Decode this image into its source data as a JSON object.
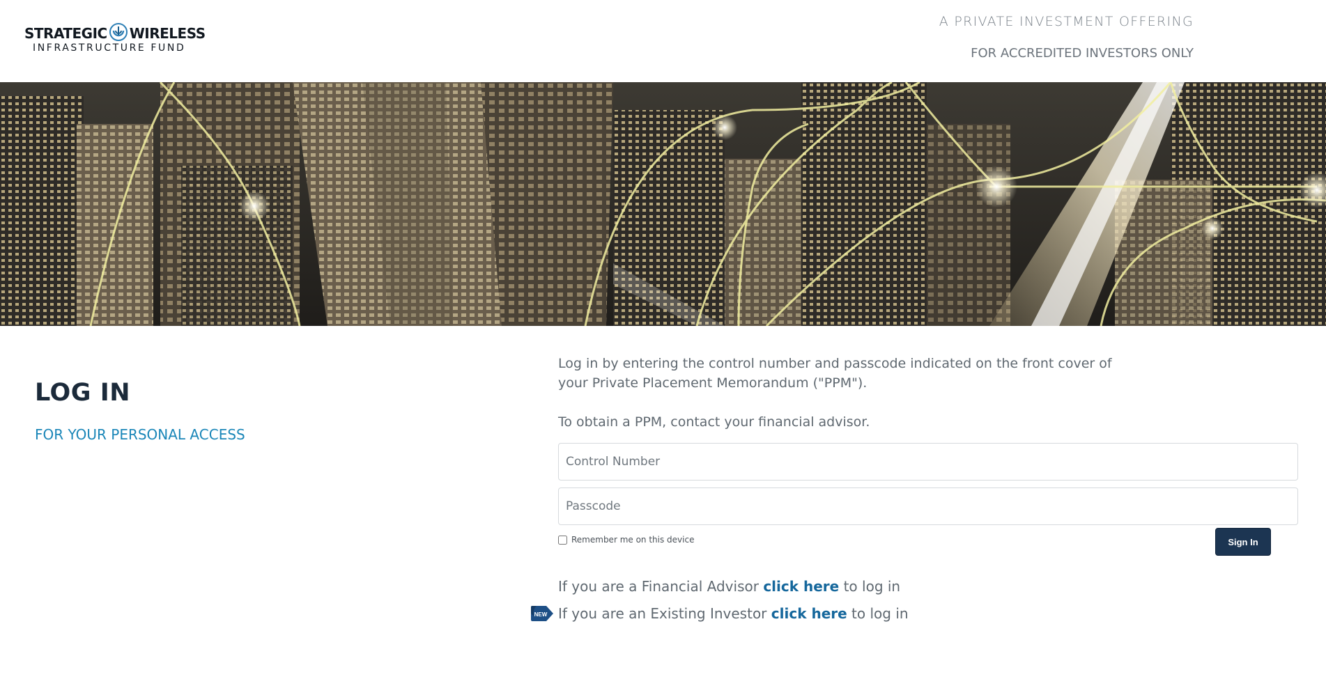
{
  "header": {
    "logo_line1_left": "STRATEGIC",
    "logo_line1_right": "WIRELESS",
    "logo_line2": "INFRASTRUCTURE FUND",
    "tagline_1": "A PRIVATE INVESTMENT OFFERING",
    "tagline_2": "FOR ACCREDITED INVESTORS ONLY"
  },
  "hero": {
    "icon": "city-network-photo"
  },
  "login": {
    "title": "LOG IN",
    "subtitle": "FOR YOUR PERSONAL ACCESS",
    "intro_1": "Log in by entering the control number and passcode indicated on the front cover of your Private Placement Memorandum (\"PPM\").",
    "intro_2": "To obtain a PPM, contact your financial advisor.",
    "control_number_placeholder": "Control Number",
    "control_number_value": "",
    "passcode_placeholder": "Passcode",
    "passcode_value": "",
    "remember_label": "Remember me on this device",
    "remember_checked": false,
    "signin_label": "Sign In"
  },
  "links": {
    "advisor_prefix": "If you are a Financial Advisor",
    "advisor_link": "click here",
    "advisor_suffix": "to log in",
    "investor_prefix": "If you are an Existing Investor",
    "investor_link": "click here",
    "investor_suffix": "to log in",
    "new_badge": "NEW"
  },
  "colors": {
    "title": "#1b2a3a",
    "accent": "#1a86b8",
    "link": "#15679c",
    "button": "#1c3552"
  }
}
